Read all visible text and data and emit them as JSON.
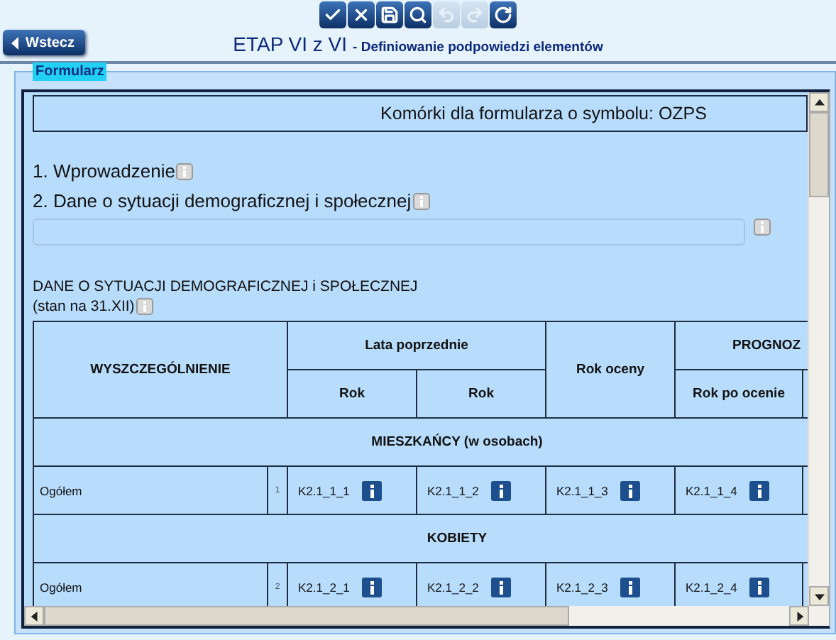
{
  "toolbar": [
    {
      "kind": "check",
      "disabled": false
    },
    {
      "kind": "cancel",
      "disabled": false
    },
    {
      "kind": "save",
      "disabled": false
    },
    {
      "kind": "search",
      "disabled": false
    },
    {
      "kind": "undo",
      "disabled": true
    },
    {
      "kind": "redo",
      "disabled": true
    },
    {
      "kind": "refresh",
      "disabled": false
    }
  ],
  "back_button": "Wstecz",
  "title": {
    "main": "ETAP VI z VI",
    "subtitle": "- Definiowanie podpowiedzi elementów"
  },
  "fieldset_legend": "Formularz",
  "form_heading": "Komórki dla formularza o symbolu: OZPS",
  "sections": [
    "1. Wprowadzenie",
    "2. Dane o sytuacji demograficznej i społecznej"
  ],
  "table_caption": [
    "DANE O SYTUACJI DEMOGRAFICZNEJ i SPOŁECZNEJ",
    "(stan na 31.XII)"
  ],
  "table": {
    "header": {
      "first": "WYSZCZEGÓLNIENIE",
      "group_1": "Lata poprzednie",
      "year_1": "Rok",
      "year_2": "Rok",
      "assessment": "Rok oceny",
      "group_2": "PROGNOZ",
      "forecast_1": "Rok po ocenie"
    },
    "rows": [
      {
        "kind": "section",
        "label": "MIESZKAŃCY (w osobach)"
      },
      {
        "kind": "data",
        "label": "Ogółem",
        "number": "1",
        "cells": [
          "K2.1_1_1",
          "K2.1_1_2",
          "K2.1_1_3",
          "K2.1_1_4"
        ]
      },
      {
        "kind": "section",
        "label": "KOBIETY"
      },
      {
        "kind": "data",
        "label": "Ogółem",
        "number": "2",
        "cells": [
          "K2.1_2_1",
          "K2.1_2_2",
          "K2.1_2_3",
          "K2.1_2_4"
        ]
      }
    ]
  }
}
